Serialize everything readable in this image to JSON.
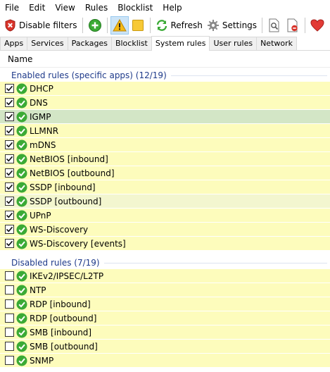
{
  "menu": [
    "File",
    "Edit",
    "View",
    "Rules",
    "Blocklist",
    "Help"
  ],
  "toolbar": {
    "disable_filters": "Disable filters",
    "refresh": "Refresh",
    "settings": "Settings"
  },
  "tabs": [
    "Apps",
    "Services",
    "Packages",
    "Blocklist",
    "System rules",
    "User rules",
    "Network"
  ],
  "active_tab": "System rules",
  "column_header": "Name",
  "enabled_group": {
    "title": "Enabled rules (specific apps) (12/19)",
    "items": [
      "DHCP",
      "DNS",
      "IGMP",
      "LLMNR",
      "mDNS",
      "NetBIOS [inbound]",
      "NetBIOS [outbound]",
      "SSDP [inbound]",
      "SSDP [outbound]",
      "UPnP",
      "WS-Discovery",
      "WS-Discovery [events]"
    ]
  },
  "disabled_group": {
    "title": "Disabled rules (7/19)",
    "items": [
      "IKEv2/IPSEC/L2TP",
      "NTP",
      "RDP [inbound]",
      "RDP [outbound]",
      "SMB [inbound]",
      "SMB [outbound]",
      "SNMP"
    ]
  },
  "colors": {
    "row_bg": "#fdfcbc",
    "selected_row_bg": "#d3e6c6",
    "group_title": "#1e3a8a",
    "ok_icon": "#3aaa35"
  }
}
